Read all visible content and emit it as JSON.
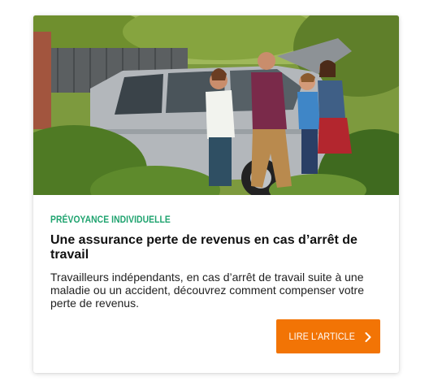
{
  "card": {
    "image": {
      "icon": "family-car-photo"
    },
    "category": "PRÉVOYANCE INDIVIDUELLE",
    "title": "Une assurance perte de revenus en cas d’arrêt de travail",
    "description": "Travailleurs indépendants, en cas d’arrêt de travail suite à une maladie ou un accident, découvrez comment compenser votre perte de revenus.",
    "cta": {
      "label": "LIRE L’ARTICLE",
      "icon": "chevron-right-icon"
    }
  },
  "colors": {
    "category": "#1fa36f",
    "cta_background": "#f27405"
  }
}
